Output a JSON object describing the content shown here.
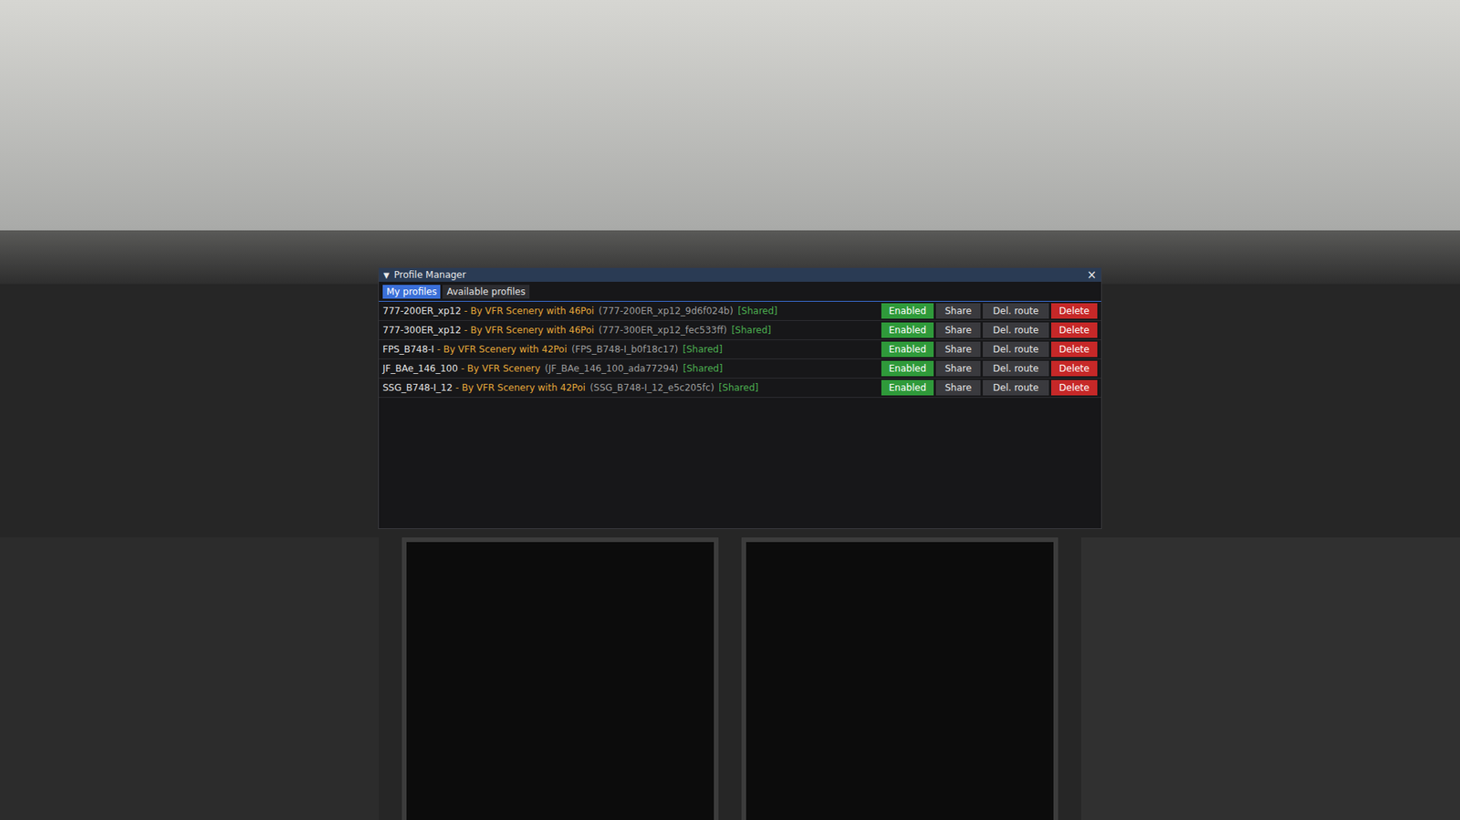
{
  "window": {
    "title": "Profile Manager",
    "collapse_glyph": "▼",
    "close_glyph": "×"
  },
  "tabs": [
    {
      "label": "My profiles",
      "selected": true
    },
    {
      "label": "Available profiles",
      "selected": false
    }
  ],
  "row_actions": [
    {
      "label": "Share",
      "kind": "plain"
    },
    {
      "label": "Del. route",
      "kind": "plain"
    },
    {
      "label": "Delete",
      "kind": "danger"
    }
  ],
  "profiles": [
    {
      "name": "777-200ER_xp12",
      "author": "- By VFR Scenery with 46Poi",
      "id": "(777-200ER_xp12_9d6f024b)",
      "tag": "[Shared]",
      "status": "Enabled",
      "enabled": true
    },
    {
      "name": "777-300ER_xp12",
      "author": "- By VFR Scenery with 46Poi",
      "id": "(777-300ER_xp12_fec533ff)",
      "tag": "[Shared]",
      "status": "Enabled",
      "enabled": true
    },
    {
      "name": "FPS_B748-I",
      "author": "- By VFR Scenery with 42Poi",
      "id": "(FPS_B748-I_b0f18c17)",
      "tag": "[Shared]",
      "status": "Enabled",
      "enabled": true
    },
    {
      "name": "JF_BAe_146_100",
      "author": "- By VFR Scenery",
      "id": "(JF_BAe_146_100_ada77294)",
      "tag": "[Shared]",
      "status": "Enabled",
      "enabled": true
    },
    {
      "name": "SSG_B748-I_12",
      "author": "- By VFR Scenery with 42Poi",
      "id": "(SSG_B748-I_12_e5c205fc)",
      "tag": "[Shared]",
      "status": "Enabled",
      "enabled": true
    }
  ]
}
